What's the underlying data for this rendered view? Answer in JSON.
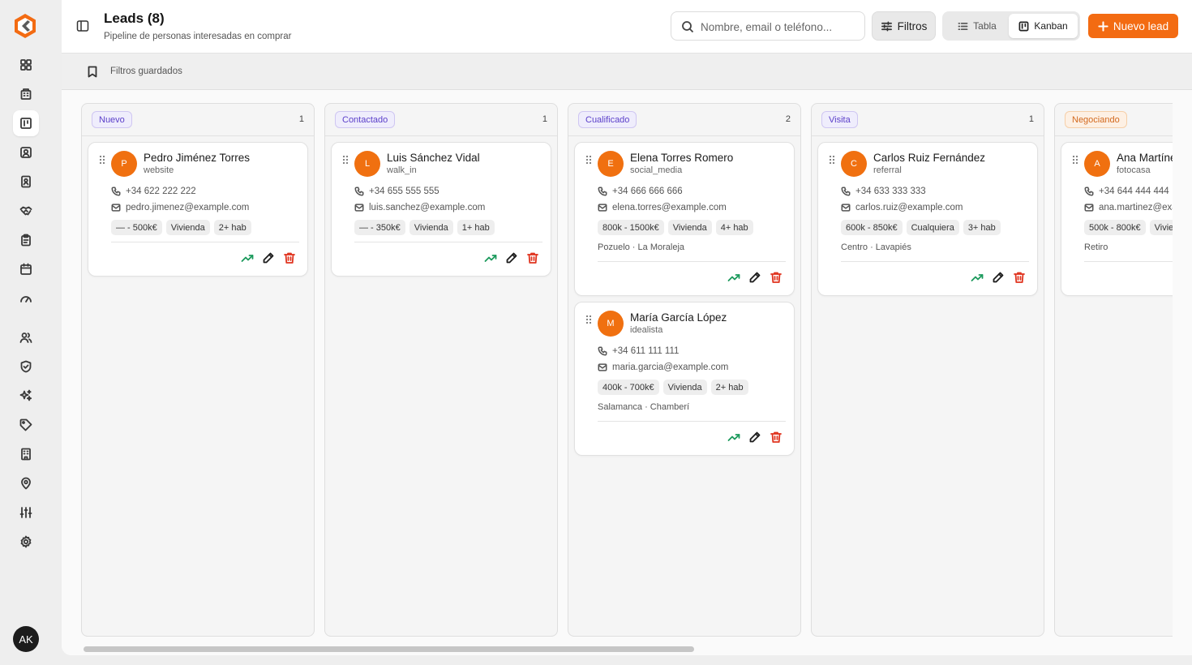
{
  "header": {
    "title": "Leads (8)",
    "subtitle": "Pipeline de personas interesadas en comprar",
    "search_placeholder": "Nombre, email o teléfono...",
    "filters_label": "Filtros",
    "view_table_label": "Tabla",
    "view_kanban_label": "Kanban",
    "new_lead_label": "Nuevo lead"
  },
  "saved_filters": {
    "label": "Filtros guardados"
  },
  "user": {
    "initials": "AK"
  },
  "colors": {
    "accent": "#f36b12",
    "trend": "#1b9a5c",
    "delete": "#e0341f",
    "badge_purple_bg": "#efedfc",
    "badge_purple_text": "#5b3fc9",
    "badge_orange_bg": "#fdf0e4",
    "badge_orange_text": "#d2691e"
  },
  "sidebar": {
    "items": [
      {
        "icon": "dashboard-icon"
      },
      {
        "icon": "building-icon"
      },
      {
        "icon": "kanban-icon",
        "active": true
      },
      {
        "icon": "contact-icon"
      },
      {
        "icon": "id-card-icon"
      },
      {
        "icon": "handshake-icon"
      },
      {
        "icon": "clipboard-icon"
      },
      {
        "icon": "calendar-icon"
      },
      {
        "icon": "gauge-icon"
      },
      {
        "icon": "users-icon"
      },
      {
        "icon": "shield-check-icon"
      },
      {
        "icon": "sparkles-icon"
      },
      {
        "icon": "tag-icon"
      },
      {
        "icon": "building-2-icon"
      },
      {
        "icon": "map-pin-icon"
      },
      {
        "icon": "sliders-icon"
      },
      {
        "icon": "settings-icon"
      }
    ]
  },
  "columns": [
    {
      "label": "Nuevo",
      "count": "1",
      "color": "purple",
      "cards": [
        {
          "initial": "P",
          "name": "Pedro Jiménez Torres",
          "source": "website",
          "phone": "+34 622 222 222",
          "email": "pedro.jimenez@example.com",
          "chips": [
            "— - 500k€",
            "Vivienda",
            "2+ hab"
          ],
          "zones": ""
        }
      ]
    },
    {
      "label": "Contactado",
      "count": "1",
      "color": "purple",
      "cards": [
        {
          "initial": "L",
          "name": "Luis Sánchez Vidal",
          "source": "walk_in",
          "phone": "+34 655 555 555",
          "email": "luis.sanchez@example.com",
          "chips": [
            "— - 350k€",
            "Vivienda",
            "1+ hab"
          ],
          "zones": ""
        }
      ]
    },
    {
      "label": "Cualificado",
      "count": "2",
      "color": "purple",
      "cards": [
        {
          "initial": "E",
          "name": "Elena Torres Romero",
          "source": "social_media",
          "phone": "+34 666 666 666",
          "email": "elena.torres@example.com",
          "chips": [
            "800k - 1500k€",
            "Vivienda",
            "4+ hab"
          ],
          "zones": "Pozuelo · La Moraleja"
        },
        {
          "initial": "M",
          "name": "María García López",
          "source": "idealista",
          "phone": "+34 611 111 111",
          "email": "maria.garcia@example.com",
          "chips": [
            "400k - 700k€",
            "Vivienda",
            "2+ hab"
          ],
          "zones": "Salamanca · Chamberí"
        }
      ]
    },
    {
      "label": "Visita",
      "count": "1",
      "color": "purple",
      "cards": [
        {
          "initial": "C",
          "name": "Carlos Ruiz Fernández",
          "source": "referral",
          "phone": "+34 633 333 333",
          "email": "carlos.ruiz@example.com",
          "chips": [
            "600k - 850k€",
            "Cualquiera",
            "3+ hab"
          ],
          "zones": "Centro · Lavapiés"
        }
      ]
    },
    {
      "label": "Negociando",
      "count": "",
      "color": "orange",
      "cards": [
        {
          "initial": "A",
          "name": "Ana Martínez",
          "source": "fotocasa",
          "phone": "+34 644 444 444",
          "email": "ana.martinez@example.com",
          "chips": [
            "500k - 800k€",
            "Vivienda"
          ],
          "zones": "Retiro"
        }
      ]
    }
  ]
}
